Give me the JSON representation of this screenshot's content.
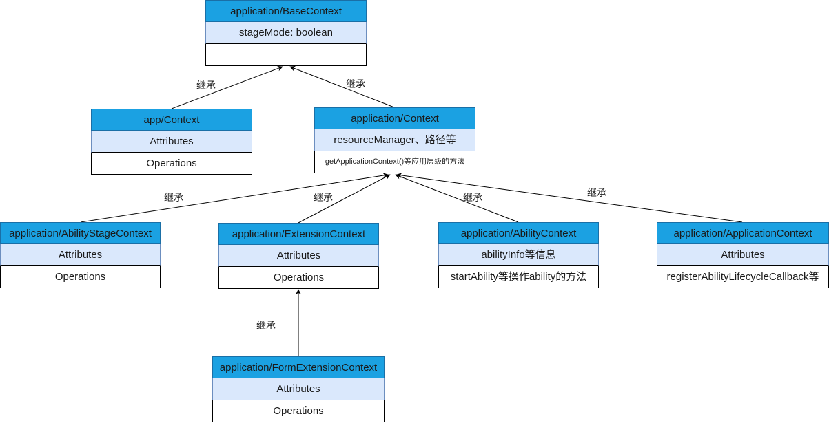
{
  "classes": [
    {
      "id": "base",
      "name": "application/BaseContext",
      "attributes": "stageMode: boolean",
      "operations": ""
    },
    {
      "id": "appctx",
      "name": "app/Context",
      "attributes": "Attributes",
      "operations": "Operations"
    },
    {
      "id": "ctx",
      "name": "application/Context",
      "attributes": "resourceManager、路径等",
      "operations": "getApplicationContext()等应用层级的方法"
    },
    {
      "id": "stage",
      "name": "application/AbilityStageContext",
      "attributes": "Attributes",
      "operations": "Operations"
    },
    {
      "id": "ext",
      "name": "application/ExtensionContext",
      "attributes": "Attributes",
      "operations": "Operations"
    },
    {
      "id": "ability",
      "name": "application/AbilityContext",
      "attributes": "abilityInfo等信息",
      "operations": "startAbility等操作ability的方法"
    },
    {
      "id": "app",
      "name": "application/ApplicationContext",
      "attributes": "Attributes",
      "operations": "registerAbilityLifecycleCallback等"
    },
    {
      "id": "form",
      "name": "application/FormExtensionContext",
      "attributes": "Attributes",
      "operations": "Operations"
    }
  ],
  "edges": [
    {
      "from": "appctx",
      "to": "base",
      "label": "继承"
    },
    {
      "from": "ctx",
      "to": "base",
      "label": "继承"
    },
    {
      "from": "stage",
      "to": "ctx",
      "label": "继承"
    },
    {
      "from": "ext",
      "to": "ctx",
      "label": "继承"
    },
    {
      "from": "ability",
      "to": "ctx",
      "label": "继承"
    },
    {
      "from": "app",
      "to": "ctx",
      "label": "继承"
    },
    {
      "from": "form",
      "to": "ext",
      "label": "继承"
    }
  ]
}
